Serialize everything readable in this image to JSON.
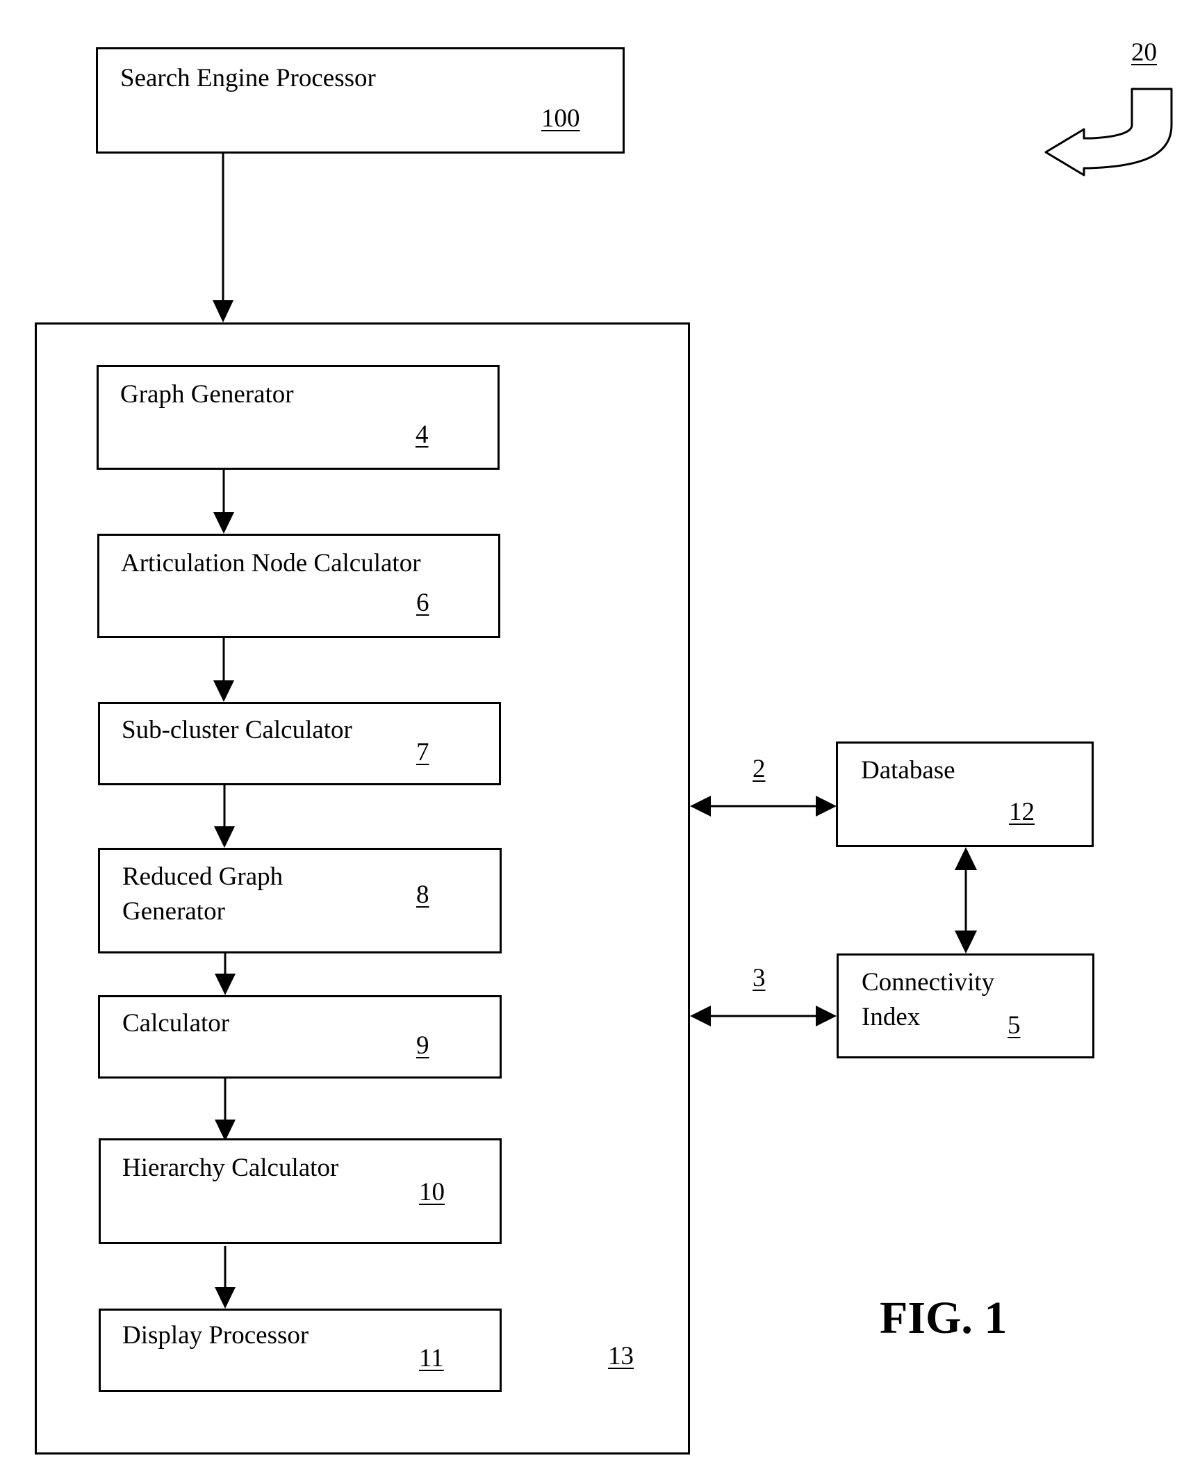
{
  "figure": {
    "title": "FIG. 1",
    "system_ref": "20",
    "container_ref": "13"
  },
  "search_engine": {
    "label": "Search Engine Processor",
    "ref": "100"
  },
  "pipeline": [
    {
      "label": "Graph Generator",
      "ref": "4"
    },
    {
      "label": "Articulation Node Calculator",
      "ref": "6"
    },
    {
      "label": "Sub-cluster Calculator",
      "ref": "7"
    },
    {
      "label_line1": "Reduced Graph",
      "label_line2": "Generator",
      "ref": "8"
    },
    {
      "label": "Calculator",
      "ref": "9"
    },
    {
      "label": "Hierarchy Calculator",
      "ref": "10"
    },
    {
      "label": "Display Processor",
      "ref": "11"
    }
  ],
  "database": {
    "label": "Database",
    "ref": "12"
  },
  "connectivity_index": {
    "label_line1": "Connectivity",
    "label_line2": "Index",
    "ref": "5"
  },
  "links": [
    {
      "ref": "2",
      "from": "container",
      "to": "database",
      "type": "bidirectional"
    },
    {
      "ref": "3",
      "from": "container",
      "to": "connectivity_index",
      "type": "bidirectional"
    },
    {
      "from": "database",
      "to": "connectivity_index",
      "type": "bidirectional"
    }
  ]
}
